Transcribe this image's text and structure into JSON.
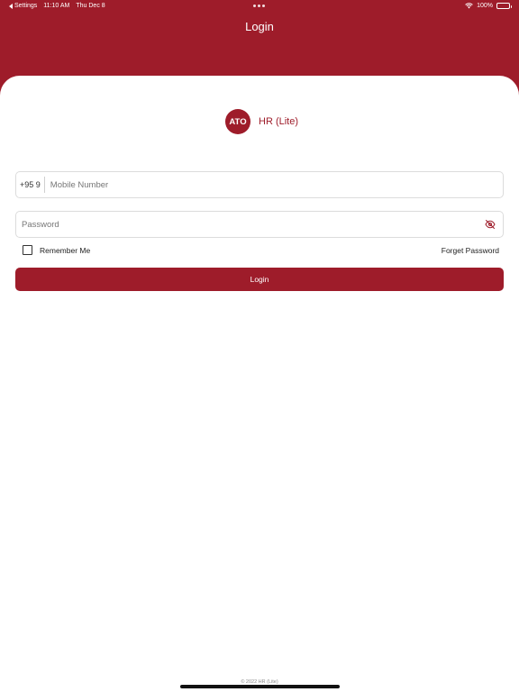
{
  "status_bar": {
    "back_label": "Settings",
    "time": "11:10 AM",
    "date": "Thu Dec 8",
    "battery": "100%"
  },
  "header": {
    "title": "Login"
  },
  "brand": {
    "logo_text": "ATO",
    "name": "HR (Lite)"
  },
  "form": {
    "mobile": {
      "prefix": "+95 9",
      "placeholder": "Mobile Number",
      "value": ""
    },
    "password": {
      "placeholder": "Password",
      "value": ""
    },
    "remember_label": "Remember Me",
    "forget_label": "Forget Password",
    "login_label": "Login"
  },
  "footer": {
    "text": "© 2022 HR (Lite)"
  },
  "colors": {
    "brand": "#9e1c2a"
  },
  "icons": {
    "password_toggle": "eye-off-icon",
    "back": "back-arrow-icon",
    "wifi": "wifi-icon",
    "battery": "battery-icon"
  }
}
